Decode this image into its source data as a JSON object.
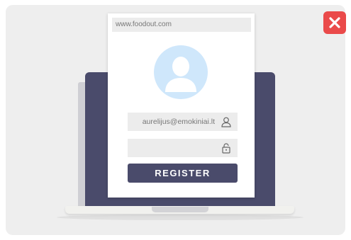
{
  "browser": {
    "url": "www.foodout.com"
  },
  "form": {
    "email_value": "aurelijus@emokiniai.lt",
    "password_value": "",
    "register_label": "REGISTER"
  },
  "icons": {
    "close": "close-icon",
    "avatar": "user-avatar-icon",
    "email_field": "user-icon",
    "password_field": "lock-icon"
  },
  "colors": {
    "close_button": "#ea4a4a",
    "laptop_screen": "#4a4b6b",
    "register_button": "#4a4b6b",
    "avatar_bg": "#cfe7fb",
    "avatar_figure": "#ffffff"
  }
}
